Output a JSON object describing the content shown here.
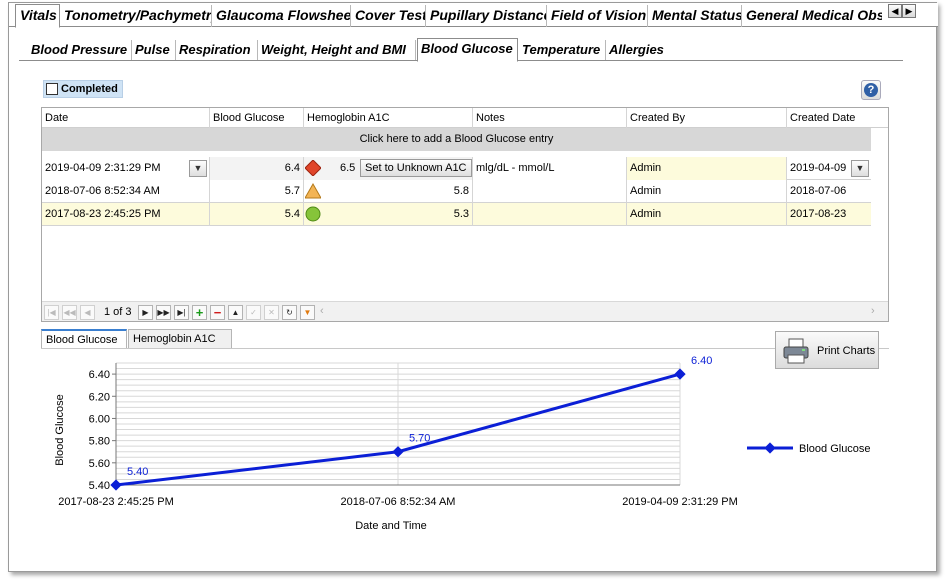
{
  "top_tabs": [
    {
      "label": "Vitals"
    },
    {
      "label": "Tonometry/Pachymetry"
    },
    {
      "label": "Glaucoma Flowsheet"
    },
    {
      "label": "Cover Test"
    },
    {
      "label": "Pupillary Distance"
    },
    {
      "label": "Field of Vision"
    },
    {
      "label": "Mental Status"
    },
    {
      "label": "General Medical Obse"
    }
  ],
  "sub_tabs": [
    {
      "label": "Blood Pressure"
    },
    {
      "label": "Pulse"
    },
    {
      "label": "Respiration"
    },
    {
      "label": "Weight, Height and BMI"
    },
    {
      "label": "Blood Glucose"
    },
    {
      "label": "Temperature"
    },
    {
      "label": "Allergies"
    }
  ],
  "completed_label": "Completed",
  "help_symbol": "?",
  "grid": {
    "columns": [
      "Date",
      "Blood Glucose",
      "Hemoglobin A1C",
      "Notes",
      "Created By",
      "Created Date"
    ],
    "add_entry_label": "Click here to add a Blood Glucose entry",
    "set_unknown_label": "Set to Unknown A1C",
    "rows": [
      {
        "date": "2019-04-09 2:31:29 PM",
        "glucose": "6.4",
        "a1c": "6.5",
        "notes": "mlg/dL - mmol/L",
        "created_by": "Admin",
        "created_date": "2019-04-09",
        "status_icon": "diamond-red-icon"
      },
      {
        "date": "2018-07-06 8:52:34 AM",
        "glucose": "5.7",
        "a1c": "5.8",
        "notes": "",
        "created_by": "Admin",
        "created_date": "2018-07-06",
        "status_icon": "triangle-orange-icon"
      },
      {
        "date": "2017-08-23 2:45:25 PM",
        "glucose": "5.4",
        "a1c": "5.3",
        "notes": "",
        "created_by": "Admin",
        "created_date": "2017-08-23",
        "status_icon": "circle-green-icon"
      }
    ],
    "pager_text": "1 of 3"
  },
  "chart_tabs": [
    {
      "label": "Blood Glucose"
    },
    {
      "label": "Hemoglobin A1C"
    }
  ],
  "print_label": "Print Charts",
  "colors": {
    "line": "#0b1fd6",
    "highlight_row": "#fdfbdc",
    "add_row": "#d7d7d7"
  },
  "chart_data": {
    "type": "line",
    "categories": [
      "2017-08-23 2:45:25 PM",
      "2018-07-06 8:52:34 AM",
      "2019-04-09 2:31:29 PM"
    ],
    "series": [
      {
        "name": "Blood Glucose",
        "values": [
          5.4,
          5.7,
          6.4
        ]
      }
    ],
    "data_labels": [
      "5.40",
      "5.70",
      "6.40"
    ],
    "y_ticks": [
      "5.40",
      "5.60",
      "5.80",
      "6.00",
      "6.20",
      "6.40"
    ],
    "ylim": [
      5.4,
      6.5
    ],
    "xlabel": "Date and Time",
    "ylabel": "Blood Glucose",
    "legend": "right",
    "grid": true
  }
}
